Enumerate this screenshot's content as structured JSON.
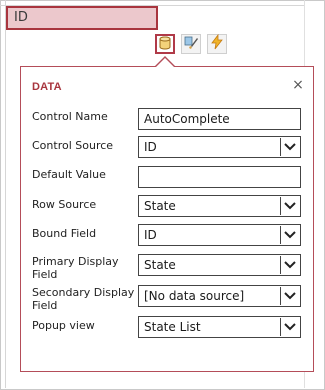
{
  "canvas": {
    "selected_control_text": "ID"
  },
  "toolbar": {
    "buttons": [
      {
        "icon": "data-cylinder-icon",
        "active": true
      },
      {
        "icon": "formatting-brush-icon",
        "active": false
      },
      {
        "icon": "actions-lightning-icon",
        "active": false
      }
    ]
  },
  "popup": {
    "title": "DATA",
    "close_label": "×",
    "fields": {
      "control_name": {
        "label": "Control Name",
        "value": "AutoComplete"
      },
      "control_source": {
        "label": "Control Source",
        "value": "ID"
      },
      "default_value": {
        "label": "Default Value",
        "value": ""
      },
      "row_source": {
        "label": "Row Source",
        "value": "State"
      },
      "bound_field": {
        "label": "Bound Field",
        "value": "ID"
      },
      "primary_display_field": {
        "label": "Primary Display Field",
        "value": "State"
      },
      "secondary_display_field": {
        "label": "Secondary Display Field",
        "value": "[No data source]"
      },
      "popup_view": {
        "label": "Popup view",
        "value": "State List"
      }
    }
  },
  "colors": {
    "accent": "#a8353e",
    "selected_fill": "#ecc8cc"
  }
}
